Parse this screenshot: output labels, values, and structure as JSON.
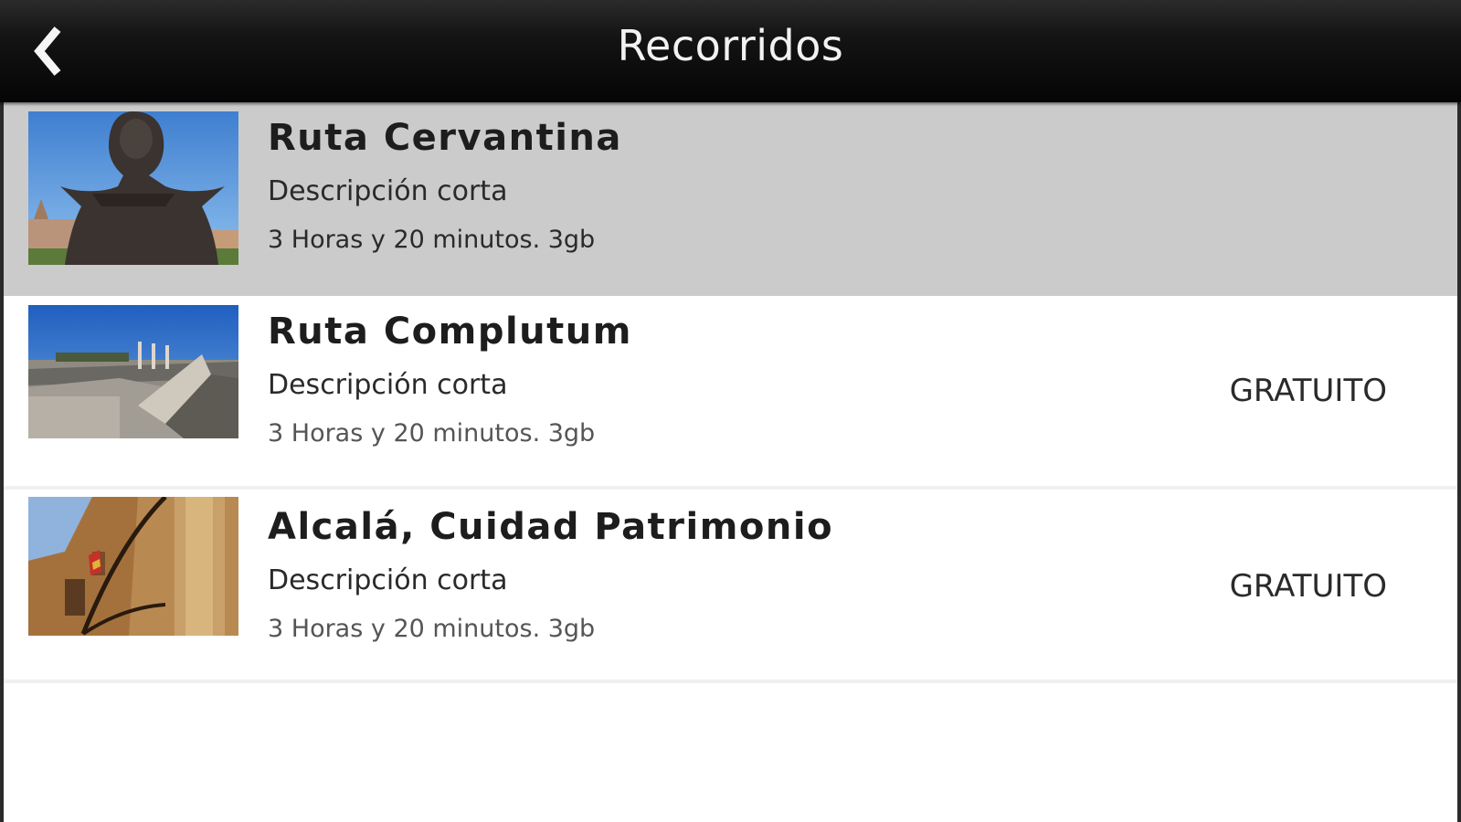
{
  "header": {
    "title": "Recorridos",
    "back_icon": "chevron-left-icon"
  },
  "routes": [
    {
      "title": "Ruta Cervantina",
      "description": "Descripción corta",
      "meta": "3 Horas y 20 minutos. 3gb",
      "price": "",
      "selected": true,
      "thumbnail": "statue-photo"
    },
    {
      "title": "Ruta Complutum",
      "description": "Descripción corta",
      "meta": "3 Horas y 20 minutos. 3gb",
      "price": "GRATUITO",
      "selected": false,
      "thumbnail": "ruins-photo"
    },
    {
      "title": "Alcalá, Cuidad Patrimonio",
      "description": "Descripción corta",
      "meta": "3 Horas y 20 minutos. 3gb",
      "price": "GRATUITO",
      "selected": false,
      "thumbnail": "building-facade-photo"
    }
  ],
  "colors": {
    "header_background": "#0a0a0a",
    "selected_row": "#cbcbcb",
    "title_text": "#1d1d1d"
  }
}
